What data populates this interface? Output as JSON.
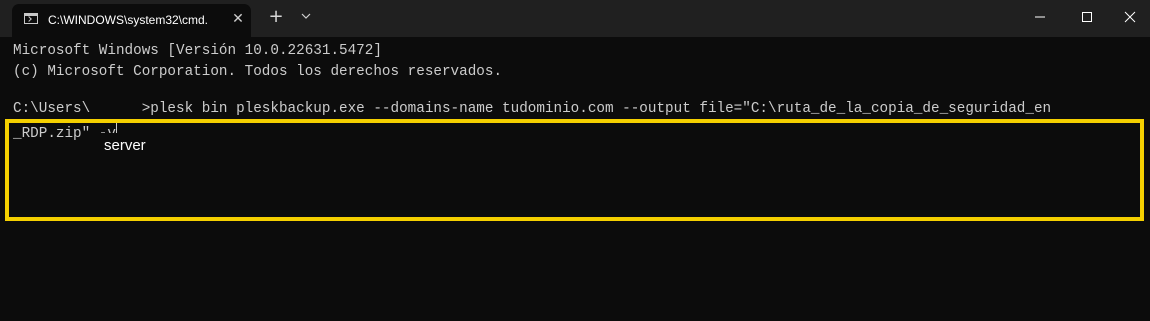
{
  "window": {
    "tab_title": "C:\\WINDOWS\\system32\\cmd.",
    "tab_icon": "terminal-icon",
    "new_tab_icon": "plus-icon",
    "dropdown_icon": "chevron-down-icon",
    "minimize_icon": "minimize-icon",
    "maximize_icon": "maximize-icon",
    "close_icon": "close-icon"
  },
  "console": {
    "lines": [
      "Microsoft Windows [Versión 10.0.22631.5472]",
      "(c) Microsoft Corporation. Todos los derechos reservados.",
      "C:\\Users\\      >plesk bin pleskbackup.exe --domains-name tudominio.com --output file=\"C:\\ruta_de_la_copia_de_seguridad_en",
      "_RDP.zip\" -v"
    ],
    "username_overlay": "server"
  },
  "colors": {
    "console_background": "#0c0c0c",
    "titlebar_background": "#202020",
    "console_text": "#cccccc",
    "highlight_border": "#f5d000"
  }
}
